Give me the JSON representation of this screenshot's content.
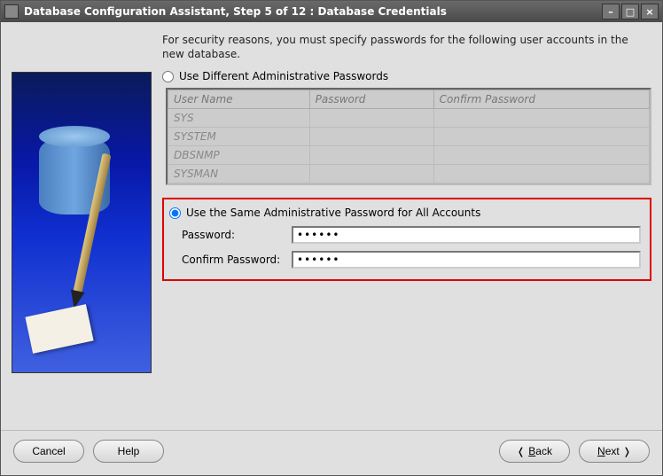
{
  "window": {
    "title": "Database Configuration Assistant, Step 5 of 12 : Database Credentials"
  },
  "instruction": "For security reasons, you must specify passwords for the following user accounts in the new database.",
  "option_different": {
    "label": "Use Different Administrative Passwords",
    "selected": false
  },
  "pwd_table": {
    "headers": {
      "user": "User Name",
      "pwd": "Password",
      "confirm": "Confirm Password"
    },
    "rows": [
      {
        "user": "SYS"
      },
      {
        "user": "SYSTEM"
      },
      {
        "user": "DBSNMP"
      },
      {
        "user": "SYSMAN"
      }
    ]
  },
  "option_same": {
    "label": "Use the Same Administrative Password for All Accounts",
    "selected": true,
    "password_label": "Password:",
    "confirm_label": "Confirm Password:",
    "password_value": "******",
    "confirm_value": "******"
  },
  "buttons": {
    "cancel": "Cancel",
    "help": "Help",
    "back": "Back",
    "back_key": "B",
    "next": "Next",
    "next_key": "N"
  }
}
